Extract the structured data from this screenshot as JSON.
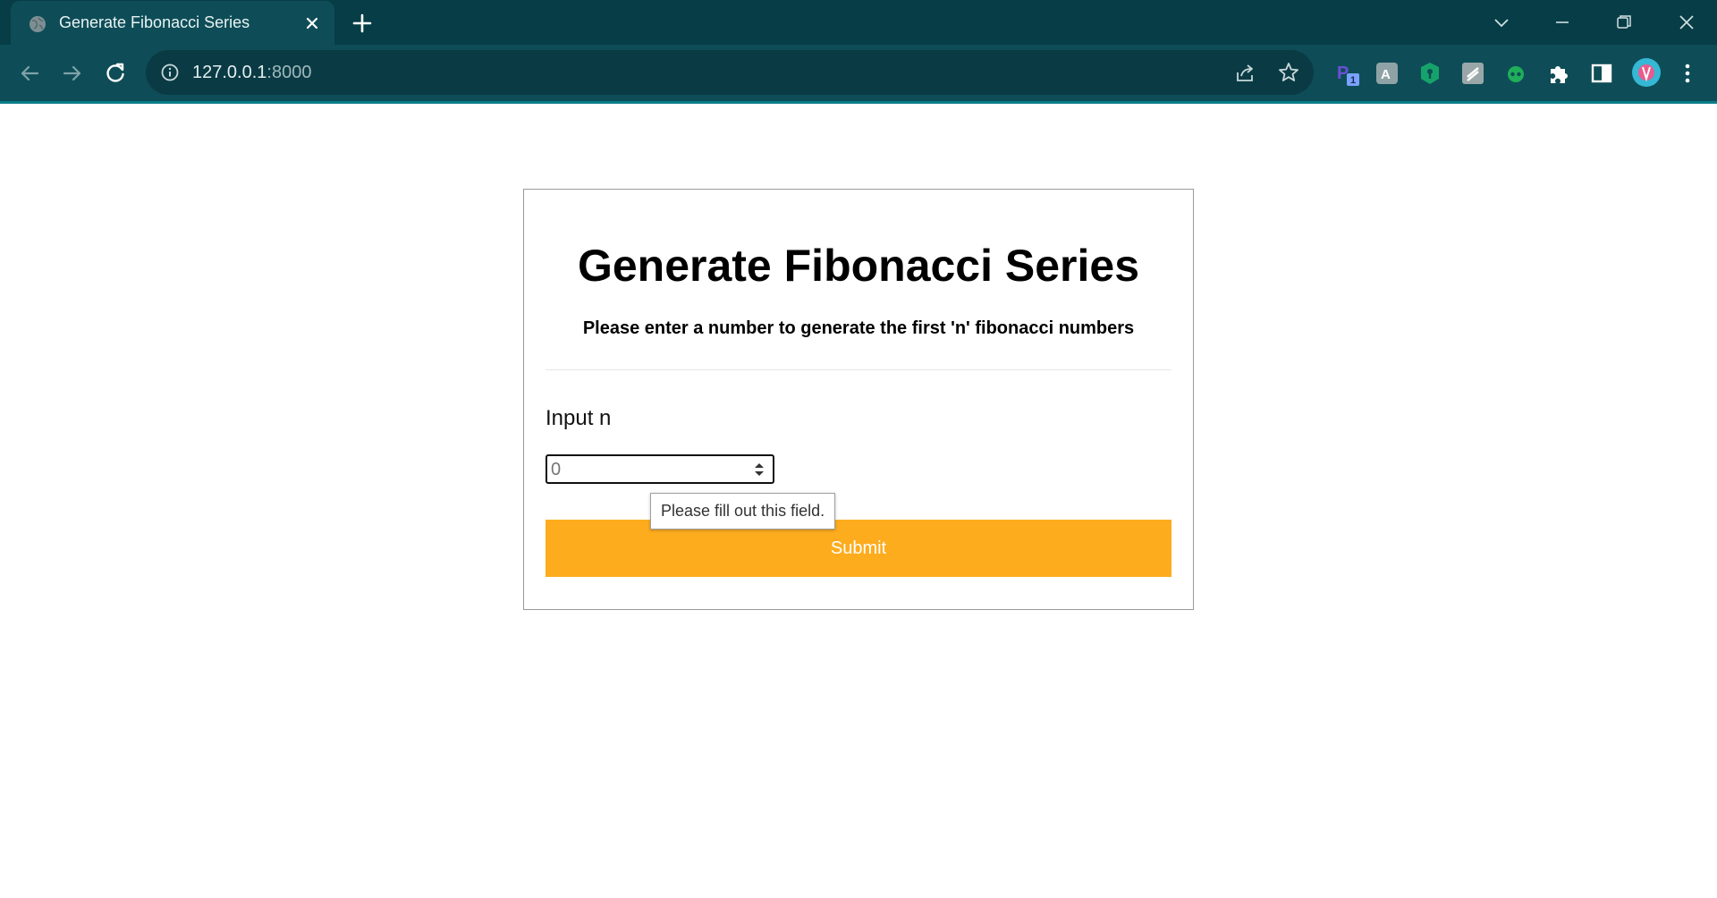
{
  "browser": {
    "tab": {
      "title": "Generate Fibonacci Series"
    },
    "address": {
      "host": "127.0.0.1",
      "port": ":8000"
    },
    "extensions": [
      {
        "name": "reader-extension-icon",
        "badge": "1"
      },
      {
        "name": "translate-extension-icon"
      },
      {
        "name": "password-manager-icon"
      },
      {
        "name": "notes-extension-icon"
      },
      {
        "name": "green-robot-extension-icon"
      },
      {
        "name": "puzzle-extensions-icon"
      },
      {
        "name": "side-panel-icon"
      },
      {
        "name": "profile-avatar"
      },
      {
        "name": "more-menu-icon"
      }
    ],
    "colors": {
      "tabstrip": "#073d46",
      "toolbar": "#0e4d57",
      "omnibox": "#0a3b44"
    }
  },
  "page": {
    "title": "Generate Fibonacci Series",
    "subtitle": "Please enter a number to generate the first 'n' fibonacci numbers",
    "input_label": "Input n",
    "input_value": "0",
    "validation_tooltip": "Please fill out this field.",
    "submit_label": "Submit",
    "colors": {
      "submit": "#fdac1e"
    }
  }
}
